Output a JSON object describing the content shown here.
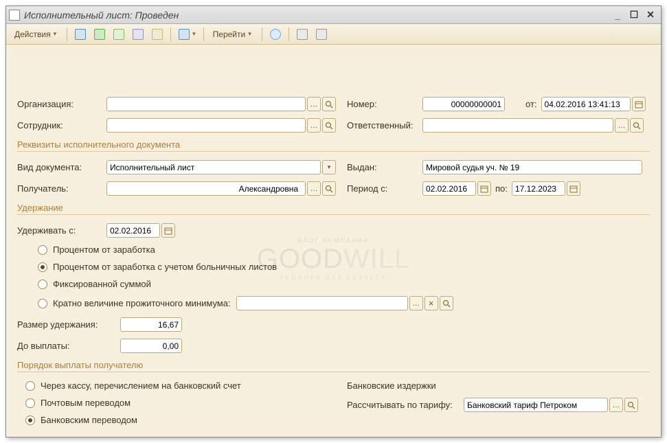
{
  "window": {
    "title": "Исполнительный лист: Проведен"
  },
  "toolbar": {
    "actions": "Действия",
    "goto": "Перейти"
  },
  "fields": {
    "organization_label": "Организация:",
    "organization_value": "",
    "employee_label": "Сотрудник:",
    "employee_value": "",
    "number_label": "Номер:",
    "number_value": "00000000001",
    "from_label": "от:",
    "from_value": "04.02.2016 13:41:13",
    "responsible_label": "Ответственный:",
    "responsible_value": ""
  },
  "section_requisites": "Реквизиты исполнительного документа",
  "requisites": {
    "doc_type_label": "Вид документа:",
    "doc_type_value": "Исполнительный лист",
    "issued_label": "Выдан:",
    "issued_value": "Мировой судья уч. № 19",
    "recipient_label": "Получатель:",
    "recipient_value": "Александровна",
    "period_from_label": "Период с:",
    "period_from_value": "02.02.2016",
    "period_to_label": "по:",
    "period_to_value": "17.12.2023"
  },
  "section_deduction": "Удержание",
  "deduction": {
    "hold_from_label": "Удерживать с:",
    "hold_from_value": "02.02.2016",
    "radio1": "Процентом от заработка",
    "radio2": "Процентом от заработка с учетом больничных листов",
    "radio3": "Фиксированной суммой",
    "radio4": "Кратно величине прожиточного минимума:",
    "size_label": "Размер удержания:",
    "size_value": "16,67",
    "until_label": "До выплаты:",
    "until_value": "0,00"
  },
  "section_payment": "Порядок выплаты получателю",
  "payment": {
    "radio1": "Через кассу, перечислением на банковский счет",
    "radio2": "Почтовым переводом",
    "radio3": "Банковским переводом",
    "bank_costs_label": "Банковские издержки",
    "tariff_label": "Рассчитывать по тарифу:",
    "tariff_value": "Банковский тариф Петроком"
  },
  "watermark": {
    "top": "БЛОГ КОМПАНИИ",
    "main1": "GOOD",
    "main2": "WILL",
    "sub": "РЕШЕНИЯ ДЛЯ БИЗНЕСА"
  }
}
